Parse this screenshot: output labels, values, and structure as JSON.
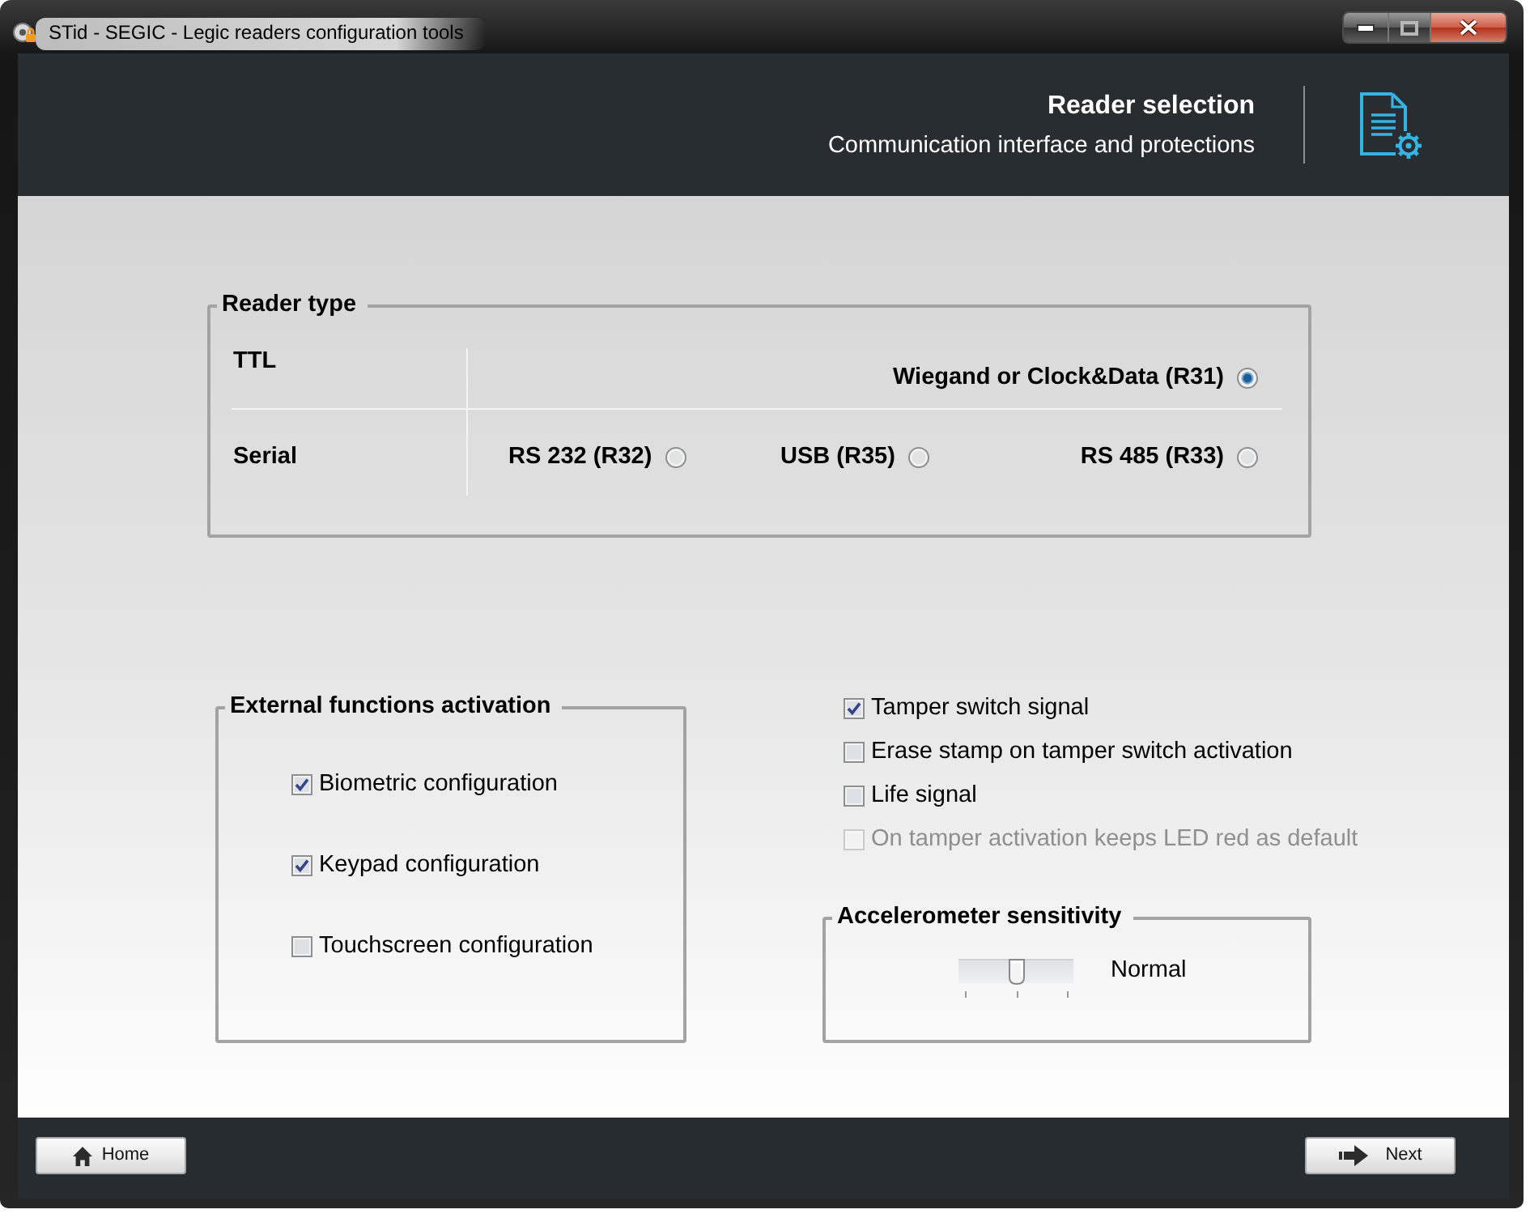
{
  "window": {
    "title": "STid - SEGIC - Legic readers configuration tools"
  },
  "header": {
    "title": "Reader selection",
    "subtitle": "Communication interface and protections"
  },
  "reader_type": {
    "legend": "Reader type",
    "groups": [
      {
        "label": "TTL",
        "options": [
          {
            "label": "Wiegand or Clock&Data (R31)",
            "selected": true
          }
        ]
      },
      {
        "label": "Serial",
        "options": [
          {
            "label": "RS 232 (R32)",
            "selected": false
          },
          {
            "label": "USB (R35)",
            "selected": false
          },
          {
            "label": "RS 485 (R33)",
            "selected": false
          }
        ]
      }
    ]
  },
  "external_functions": {
    "legend": "External functions activation",
    "items": [
      {
        "label": "Biometric configuration",
        "checked": true
      },
      {
        "label": "Keypad configuration",
        "checked": true
      },
      {
        "label": "Touchscreen configuration",
        "checked": false
      }
    ]
  },
  "tamper_options": [
    {
      "label": "Tamper switch signal",
      "checked": true,
      "disabled": false
    },
    {
      "label": "Erase stamp on tamper switch activation",
      "checked": false,
      "disabled": false
    },
    {
      "label": "Life signal",
      "checked": false,
      "disabled": false
    },
    {
      "label": "On tamper activation keeps LED red as default",
      "checked": false,
      "disabled": true
    }
  ],
  "accelerometer": {
    "legend": "Accelerometer sensitivity",
    "level": 0.5,
    "reading": "Normal"
  },
  "footer": {
    "buttons": [
      {
        "label": "Home",
        "kind": "home"
      },
      {
        "label": "Next",
        "kind": "next"
      }
    ]
  }
}
